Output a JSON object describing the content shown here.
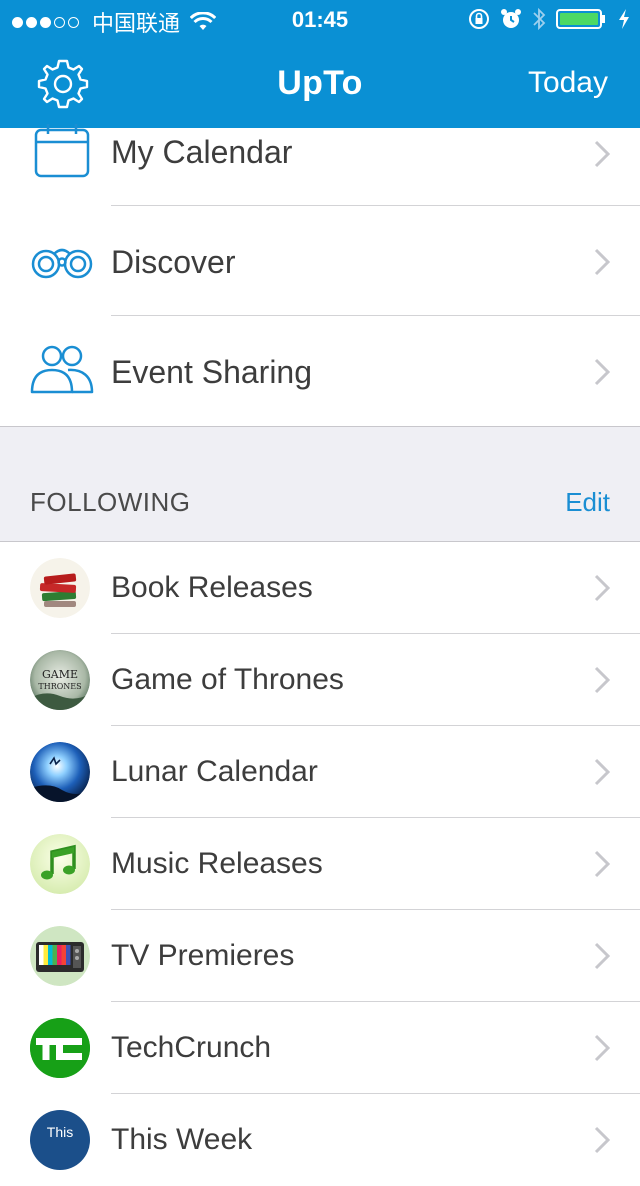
{
  "status_bar": {
    "carrier": "中国联通",
    "time": "01:45"
  },
  "nav": {
    "title": "UpTo",
    "right_button": "Today"
  },
  "menu": [
    {
      "label": "My Calendar",
      "icon": "calendar-icon"
    },
    {
      "label": "Discover",
      "icon": "binoculars-icon"
    },
    {
      "label": "Event Sharing",
      "icon": "people-icon"
    }
  ],
  "following": {
    "header": "FOLLOWING",
    "edit": "Edit",
    "items": [
      {
        "label": "Book Releases",
        "icon": "books-icon"
      },
      {
        "label": "Game of Thrones",
        "icon": "game-of-thrones-icon"
      },
      {
        "label": "Lunar Calendar",
        "icon": "moon-icon"
      },
      {
        "label": "Music Releases",
        "icon": "music-note-icon"
      },
      {
        "label": "TV Premieres",
        "icon": "tv-icon"
      },
      {
        "label": "TechCrunch",
        "icon": "techcrunch-icon",
        "avatar_text": "TC"
      },
      {
        "label": "This Week",
        "icon": "this-week-icon",
        "avatar_text": "This"
      }
    ]
  },
  "colors": {
    "brand_blue": "#0a90d4",
    "link_blue": "#1a8ed3",
    "section_bg": "#efeff4"
  }
}
